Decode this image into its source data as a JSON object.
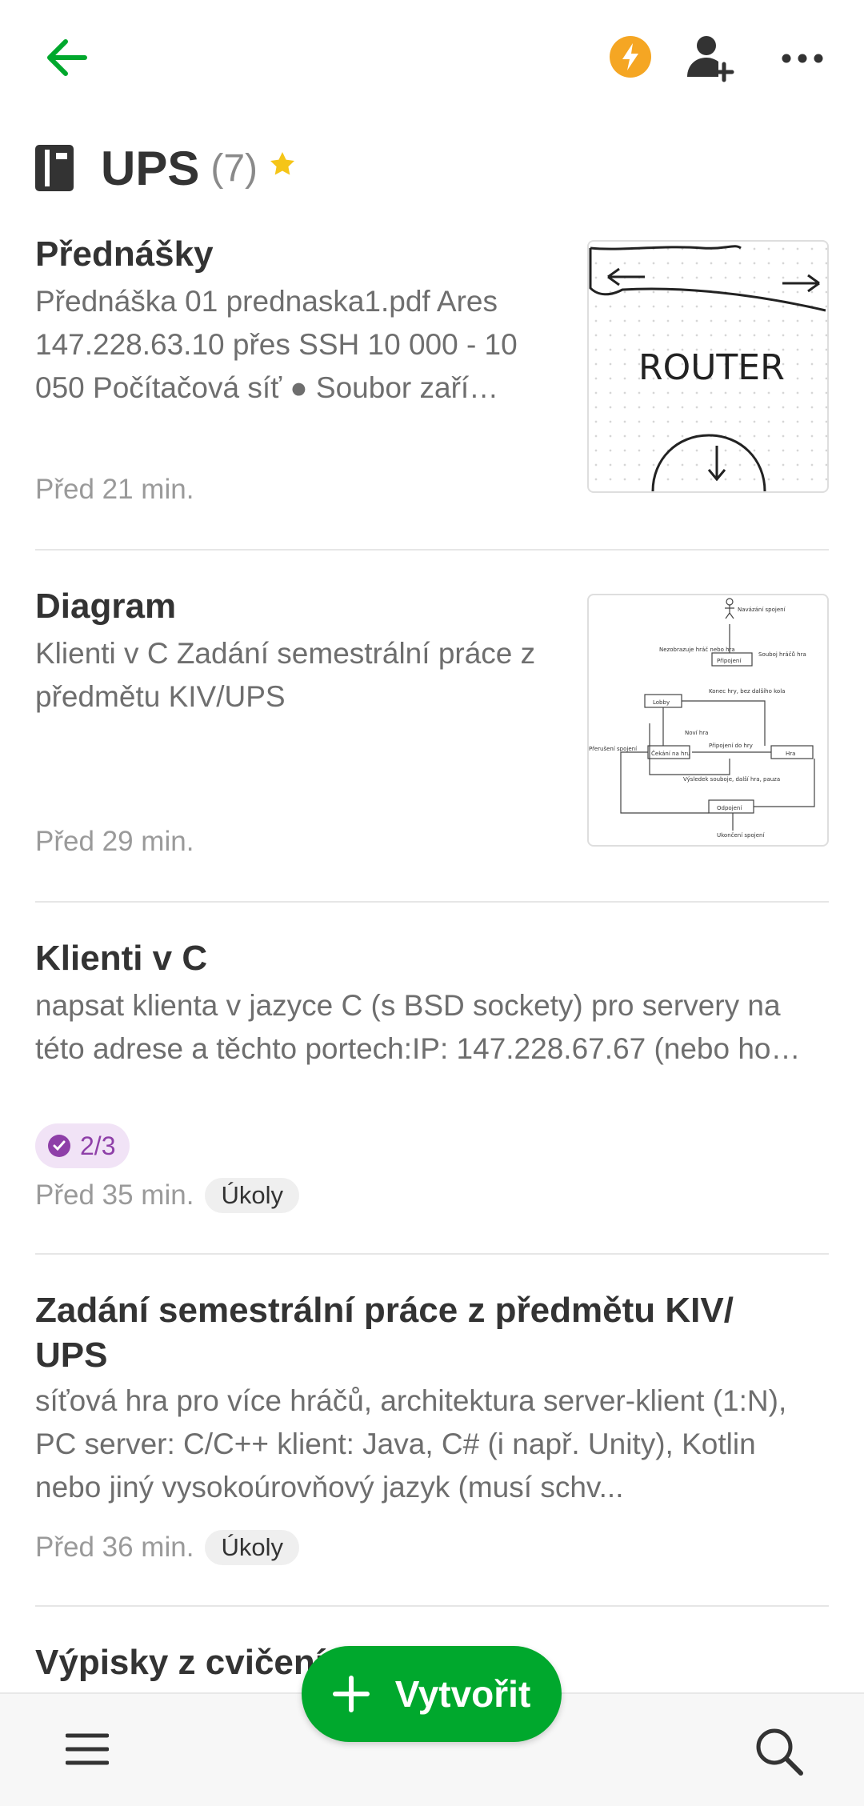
{
  "header": {
    "notebook_title": "UPS",
    "note_count": "(7)",
    "icons": [
      "back-arrow-icon",
      "lightning-bolt-icon",
      "add-person-icon",
      "more-options-icon",
      "notebook-icon",
      "star-icon"
    ]
  },
  "notes": [
    {
      "title": "Přednášky",
      "snippet": "Přednáška 01 prednaska1.pdf Ares 147.228.63.10 přes SSH 10 000 - 10 050 Počítačová síť ● Soubor zaří…",
      "time": "Před 21 min.",
      "thumbnail_text": "ROUTER"
    },
    {
      "title": "Diagram",
      "snippet": "Klienti v C Zadání semestrální práce z předmětu KIV/UPS",
      "time": "Před 29 min.",
      "thumbnail_labels": [
        "Navázání spojení",
        "Připojení",
        "Nezobrazuje hráč nebo hra",
        "Souboj hráčů hra",
        "Lobby",
        "Konec hry, bez dalšího kola",
        "Noví hra",
        "Čekání na hru",
        "Připojení do hry",
        "Hra",
        "Přerušení spojení",
        "Výsledek souboje, další hra, pauza",
        "Odpojení",
        "Ukončení spojení"
      ]
    },
    {
      "title": "Klienti v C",
      "snippet": "napsat klienta v jazyce C (s BSD sockety) pro servery na této adrese a těchto portech:IP: 147.228.67.67 (nebo ho…",
      "task_badge": "2/3",
      "time": "Před 35 min.",
      "tag": "Úkoly"
    },
    {
      "title": "Zadání semestrální práce z předmětu KIV/ UPS",
      "snippet": "síťová hra pro více hráčů, architektura server-klient (1:N), PC server: C/C++ klient: Java, C# (i např. Unity), Kotlin nebo jiný vysokoúrovňový jazyk (musí schv...",
      "time": "Před 36 min.",
      "tag": "Úkoly"
    },
    {
      "title": "Výpisky z cvičení 3"
    }
  ],
  "fab": {
    "label": "Vytvořit"
  },
  "bottom_nav": {
    "icons": [
      "menu-icon",
      "search-icon"
    ]
  },
  "colors": {
    "accent": "#00a82d",
    "bolt": "#f5a623",
    "task": "#8e3fa8",
    "star": "#f5c518"
  }
}
